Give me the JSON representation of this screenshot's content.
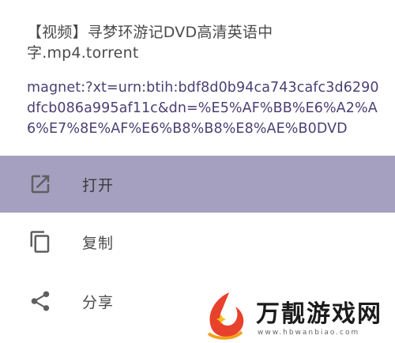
{
  "header": {
    "file_title": "【视频】寻梦环游记DVD高清英语中字.mp4.torrent",
    "magnet_link": "magnet:?xt=urn:btih:bdf8d0b94ca743cafc3d6290dfcb086a995af11c&dn=%E5%AF%BB%E6%A2%A6%E7%8E%AF%E6%B8%B8%E8%AE%B0DVD"
  },
  "menu": {
    "items": [
      {
        "label": "打开",
        "icon": "open-in-new-icon",
        "highlighted": true
      },
      {
        "label": "复制",
        "icon": "copy-icon",
        "highlighted": false
      },
      {
        "label": "分享",
        "icon": "share-icon",
        "highlighted": false
      }
    ],
    "highlight_color": "#a59fc0",
    "icon_color": "#5f5f5f"
  },
  "watermark": {
    "brand": "万靓游戏网",
    "url": "www.hbwanbiao.com"
  }
}
